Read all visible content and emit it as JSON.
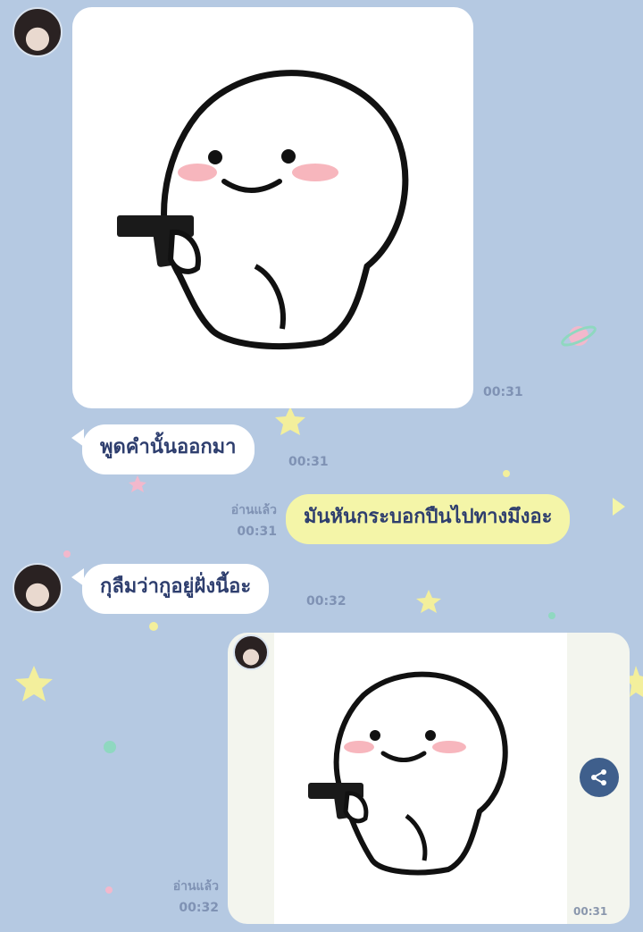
{
  "messages": [
    {
      "type": "sticker",
      "direction": "incoming",
      "sticker": "white-blob-with-gun",
      "time": "00:31"
    },
    {
      "type": "text",
      "direction": "incoming",
      "text": "พูดคำนั้นออกมา",
      "time": "00:31"
    },
    {
      "type": "text",
      "direction": "outgoing",
      "text": "มันหันกระบอกปืนไปทางมึงอะ",
      "read": "อ่านแล้ว",
      "time": "00:31"
    },
    {
      "type": "text",
      "direction": "incoming",
      "text": "กุลืมว่ากูอยู่ฝั่งนี้อะ",
      "time": "00:32"
    },
    {
      "type": "sticker",
      "direction": "outgoing",
      "sticker": "white-blob-with-gun",
      "read": "อ่านแล้ว",
      "time": "00:32",
      "inner_time": "00:31"
    }
  ],
  "icons": {
    "share": "share-icon",
    "avatar": "avatar"
  },
  "colors": {
    "background": "#b5c9e2",
    "incoming_bubble": "#ffffff",
    "outgoing_bubble": "#f4f5a8",
    "text": "#2e3e6e",
    "meta": "#7f92b4"
  }
}
